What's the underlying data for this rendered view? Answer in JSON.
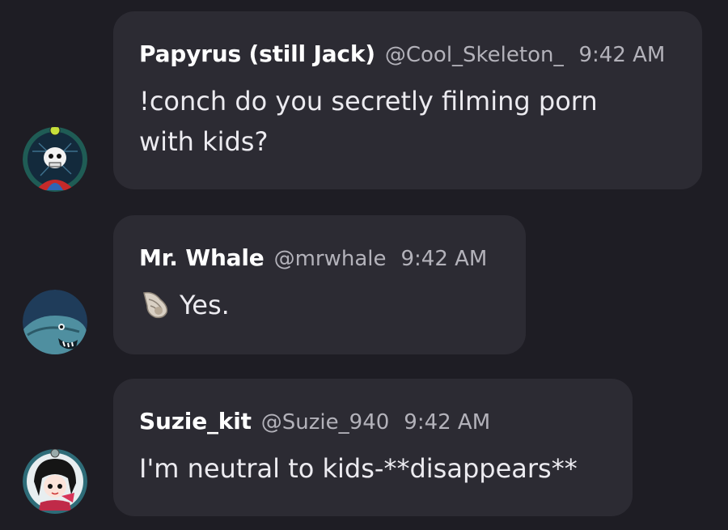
{
  "messages": [
    {
      "username": "Papyrus (still Jack)",
      "handle": "@Cool_Skeleton_",
      "timestamp": "9:42 AM",
      "text": "!conch do you secretly filming porn with kids?",
      "avatar_icon": "skeleton-avatar-icon"
    },
    {
      "username": "Mr. Whale",
      "handle": "@mrwhale",
      "timestamp": "9:42 AM",
      "text": "Yes.",
      "leading_icon": "conch-shell-icon",
      "avatar_icon": "whale-avatar-icon"
    },
    {
      "username": "Suzie_kit",
      "handle": "@Suzie_940",
      "timestamp": "9:42 AM",
      "text": "I'm neutral to kids-**disappears**",
      "avatar_icon": "anime-girl-avatar-icon"
    }
  ],
  "colors": {
    "background": "#1e1d24",
    "bubble": "#2c2b33",
    "username": "#ffffff",
    "meta": "#b3b2ba",
    "text": "#ecebf0"
  }
}
